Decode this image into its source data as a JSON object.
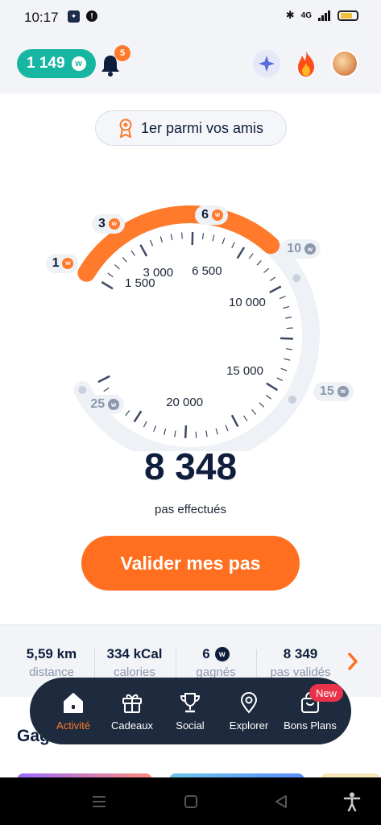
{
  "status_bar": {
    "time": "10:17",
    "network": "4G"
  },
  "header": {
    "points": "1 149",
    "points_currency": "w",
    "notifications_count": "5"
  },
  "rank": {
    "label": "1er parmi vos amis"
  },
  "gauge": {
    "current_steps": 8348,
    "max_steps": 25000,
    "tick_labels": [
      "1 500",
      "3 000",
      "6 500",
      "10 000",
      "15 000",
      "20 000"
    ],
    "rewards": [
      {
        "value": "1",
        "reached": true
      },
      {
        "value": "3",
        "reached": true
      },
      {
        "value": "6",
        "reached": true
      },
      {
        "value": "10",
        "reached": false
      },
      {
        "value": "15",
        "reached": false
      },
      {
        "value": "25",
        "reached": false
      }
    ],
    "colors": {
      "progress": "#ff7a2b",
      "track": "#eef1f5"
    }
  },
  "steps": {
    "count": "8 348",
    "caption": "pas effectués"
  },
  "validate_button": {
    "label": "Valider mes pas"
  },
  "stats": {
    "distance": {
      "value": "5,59 km",
      "label": "distance"
    },
    "calories": {
      "value": "334 kCal",
      "label": "calories"
    },
    "earned": {
      "value": "6",
      "label": "gagnés"
    },
    "validated": {
      "value": "8 349",
      "label": "pas validés"
    }
  },
  "section": {
    "title": "Gag"
  },
  "nav": {
    "items": [
      {
        "label": "Activité",
        "icon": "home-icon",
        "active": true
      },
      {
        "label": "Cadeaux",
        "icon": "gift-icon",
        "active": false
      },
      {
        "label": "Social",
        "icon": "trophy-icon",
        "active": false
      },
      {
        "label": "Explorer",
        "icon": "location-pin-icon",
        "active": false
      },
      {
        "label": "Bons Plans",
        "icon": "shopping-bag-icon",
        "active": false
      }
    ],
    "new_badge": "New"
  },
  "colors": {
    "accent": "#ff6f1f",
    "teal": "#17b6a3",
    "navy": "#0f1e3c",
    "nav_bg": "#1e2a3d"
  }
}
